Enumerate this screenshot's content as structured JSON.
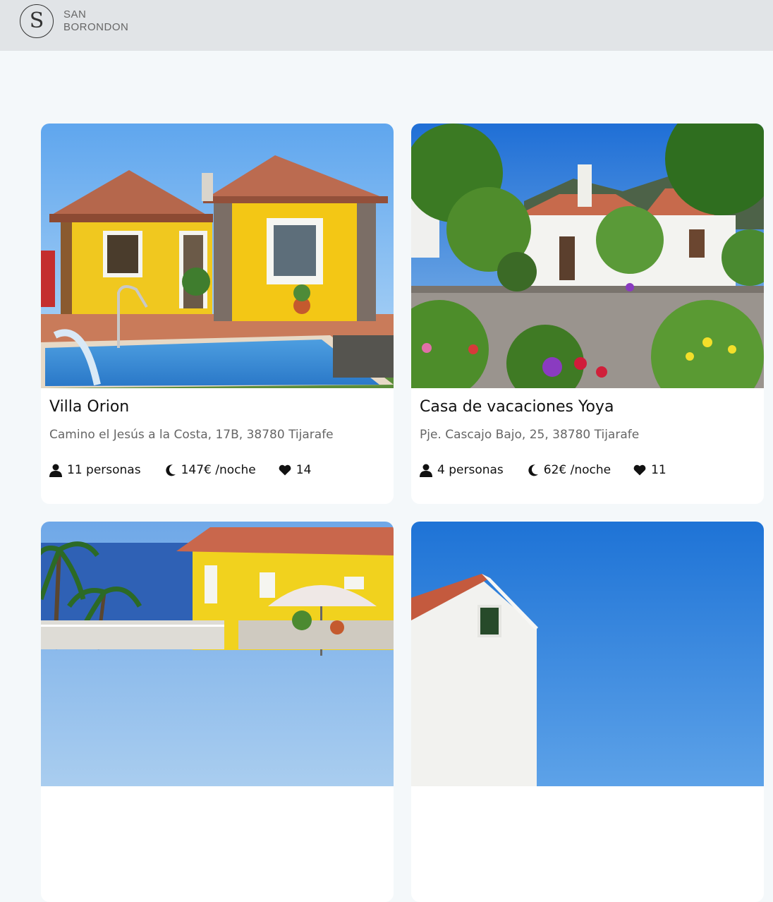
{
  "header": {
    "logo_mark": "S",
    "brand_line1": "SAN",
    "brand_line2": "BORONDON"
  },
  "listings": [
    {
      "name": "Villa Orion",
      "address": "Camino el Jesús a la Costa, 17B, 38780 Tijarafe",
      "guests": "11 personas",
      "price": "147€ /noche",
      "likes": "14"
    },
    {
      "name": "Casa de vacaciones Yoya",
      "address": "Pje. Cascajo Bajo, 25, 38780 Tijarafe",
      "guests": "4 personas",
      "price": "62€ /noche",
      "likes": "11"
    },
    {
      "name": "",
      "address": "",
      "guests": "",
      "price": "",
      "likes": ""
    },
    {
      "name": "",
      "address": "",
      "guests": "",
      "price": "",
      "likes": ""
    }
  ],
  "icons": {
    "guests": "person-icon",
    "price": "moon-icon",
    "likes": "heart-icon"
  }
}
